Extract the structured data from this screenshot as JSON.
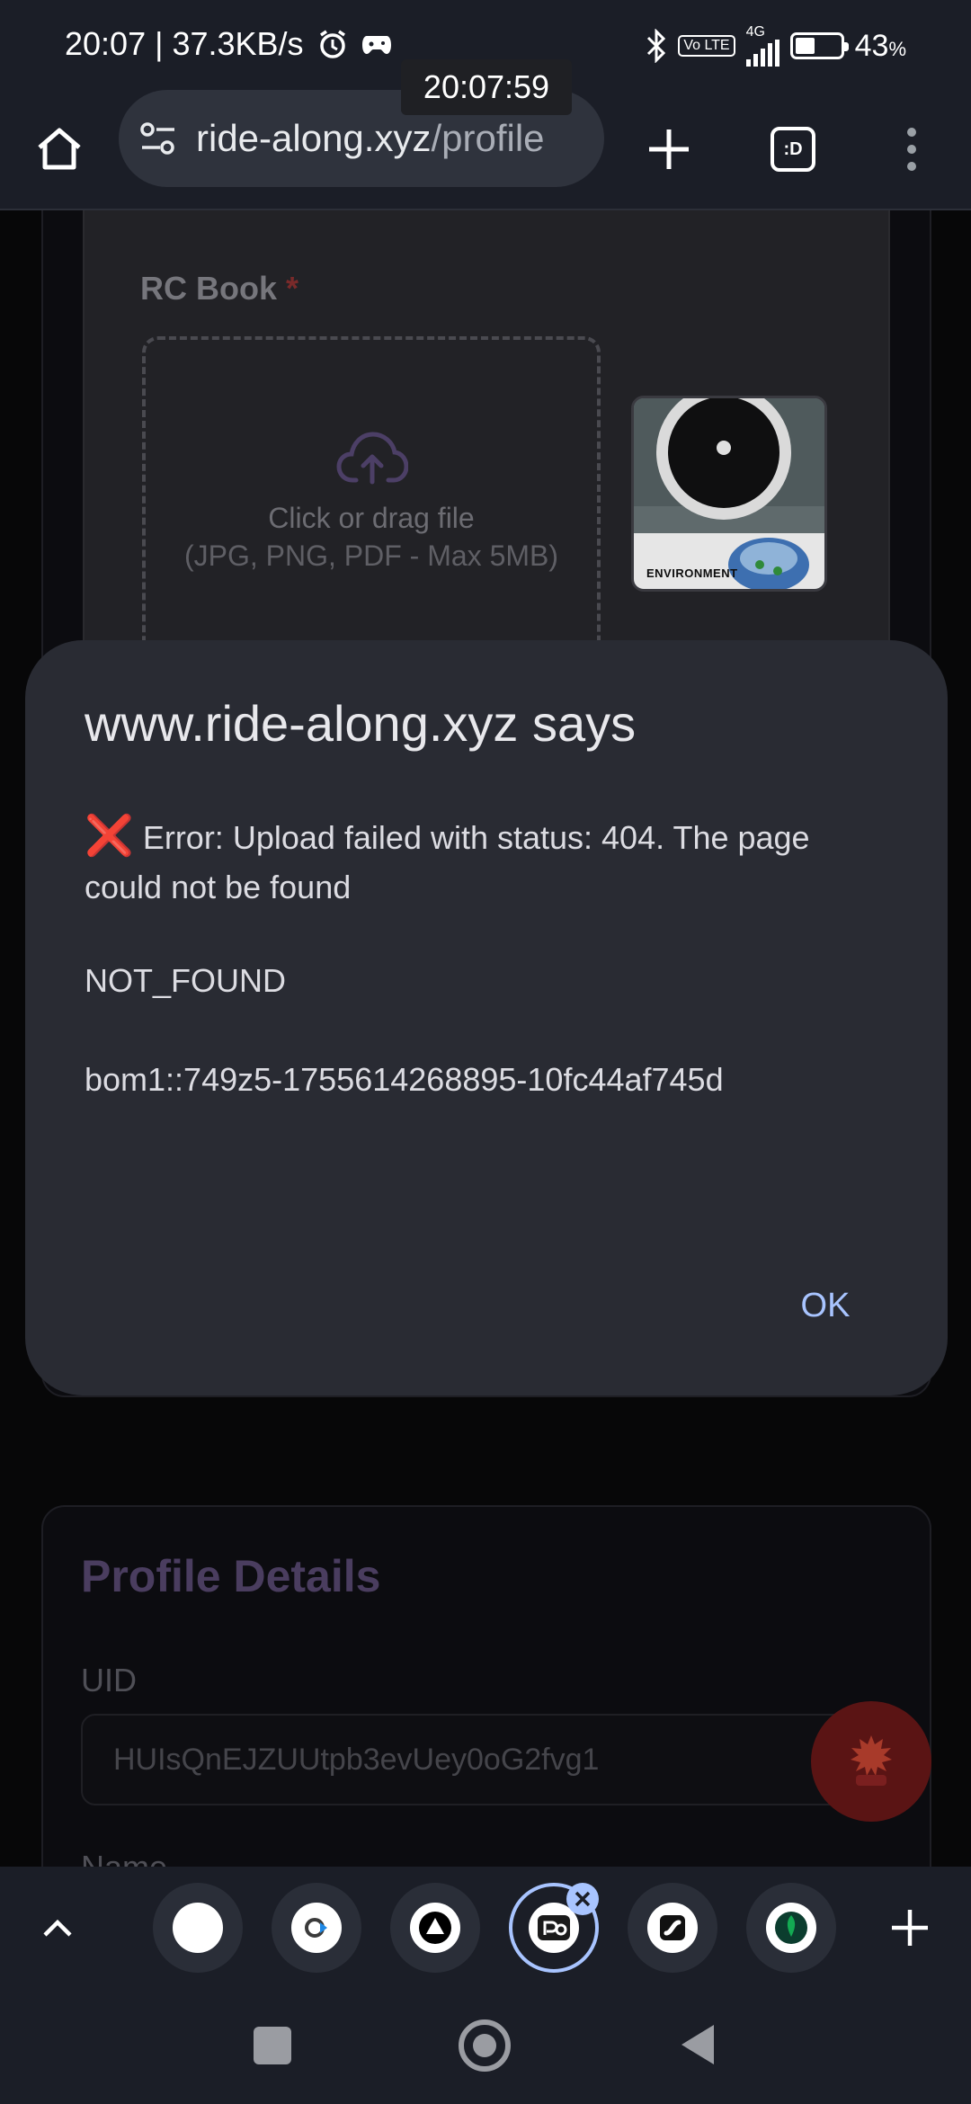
{
  "status_bar": {
    "time_speed": "20:07 | 37.3KB/s",
    "network": "4G",
    "volte": "Vo LTE",
    "battery_percent": "43",
    "battery_level": 0.43,
    "percent_sign": "%"
  },
  "clock_tooltip": "20:07:59",
  "browser": {
    "url_host": "ride-along.xyz",
    "url_path": "/profile",
    "tabs_label": ":D"
  },
  "upload": {
    "label": "RC Book",
    "required_mark": "*",
    "drop_text": "Click or drag file",
    "drop_hint": "(JPG, PNG, PDF - Max 5MB)",
    "thumb_caption": "ENVIRONMENT"
  },
  "profile": {
    "title": "Profile Details",
    "uid_label": "UID",
    "uid_value": "HUIsQnEJZUUtpb3evUey0oG2fvg1",
    "name_label": "Name"
  },
  "dialog": {
    "title": "www.ride-along.xyz says",
    "error_icon": "❌",
    "error_text": "Error: Upload failed with status: 404. The page could not be found",
    "code": "NOT_FOUND",
    "request_id": "bom1::749z5-1755614268895-10fc44af745d",
    "ok_label": "OK"
  },
  "colors": {
    "accent_link": "#a8c4ff",
    "dialog_bg": "#292b33",
    "fab": "#5a1414"
  }
}
